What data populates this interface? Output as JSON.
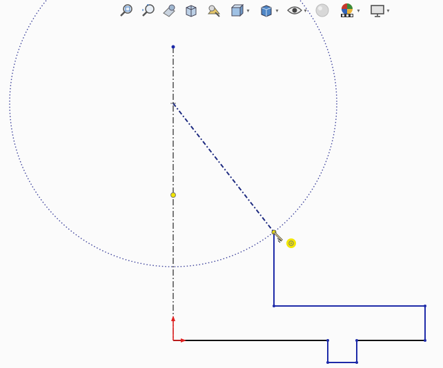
{
  "toolbar": {
    "tools": [
      {
        "icon": "zoom-to-fit-icon",
        "has_dropdown": false
      },
      {
        "icon": "zoom-to-area-icon",
        "has_dropdown": false
      },
      {
        "icon": "previous-view-icon",
        "has_dropdown": false
      },
      {
        "icon": "section-view-icon",
        "has_dropdown": false
      },
      {
        "icon": "dynamic-annotation-views-icon",
        "has_dropdown": false
      },
      {
        "icon": "view-orientation-icon",
        "has_dropdown": true
      },
      {
        "icon": "display-style-icon",
        "has_dropdown": true
      },
      {
        "icon": "hide-show-items-icon",
        "has_dropdown": true
      },
      {
        "icon": "edit-appearance-icon",
        "has_dropdown": false
      },
      {
        "icon": "apply-scene-icon",
        "has_dropdown": true
      },
      {
        "icon": "view-settings-icon",
        "has_dropdown": true
      }
    ]
  },
  "sketch": {
    "construction_circle_color": "#3a3f9a",
    "profile_color": "#1d2aa8",
    "fixed_line_color": "#111111",
    "centerline_color": "#222222",
    "origin_color": "#e02020",
    "point_highlight_color": "#f2e600"
  }
}
